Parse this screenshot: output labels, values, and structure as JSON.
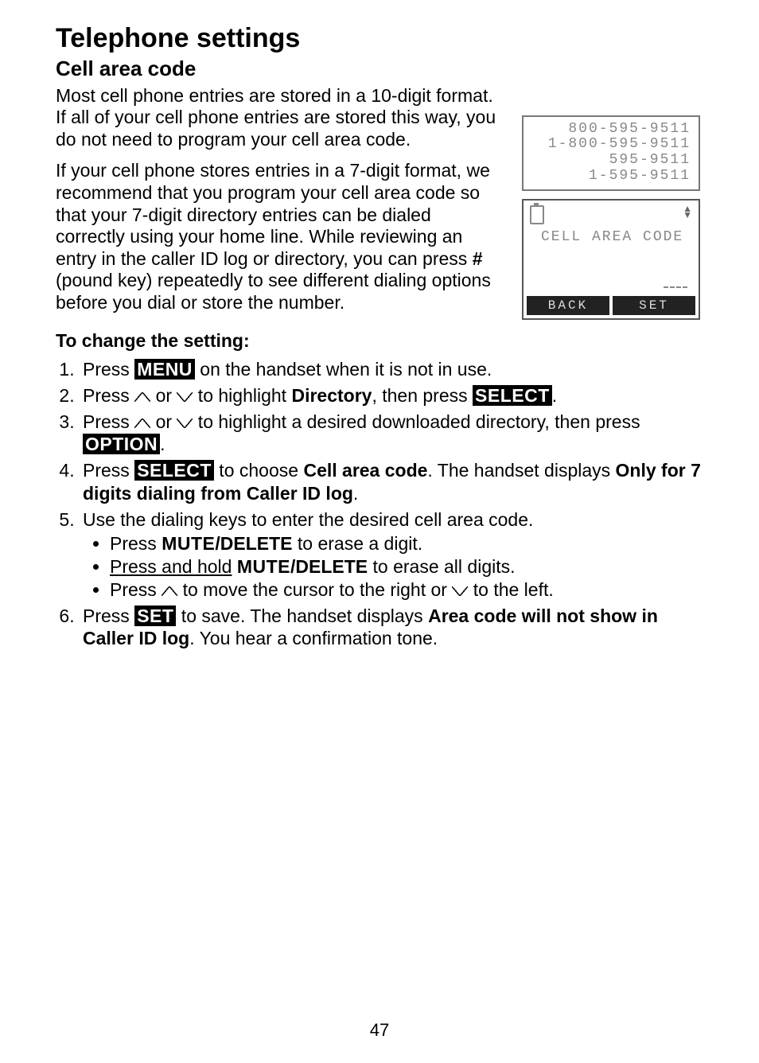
{
  "page": {
    "title": "Telephone settings",
    "subtitle": "Cell area code",
    "number": "47"
  },
  "body": {
    "p1": "Most cell phone entries are stored in a 10-digit format. If all of your cell phone entries are stored this way, you do not need to program your cell area code.",
    "p2a": "If your cell phone stores entries in a 7-digit format, we recommend that you program your cell area code so that your 7-digit directory entries can be dialed correctly using your home line. While reviewing an entry in the caller ID log or directory, you can press ",
    "pound": "#",
    "p2b": " (pound key) repeatedly to see different dialing options before you dial or store the number.",
    "instrHeading": "To change the setting:"
  },
  "keys": {
    "menu": "MENU",
    "select": "SELECT",
    "option": "OPTION",
    "set": "SET",
    "mute": "MUTE",
    "delete": "/DELETE"
  },
  "steps": {
    "s1a": "Press ",
    "s1b": " on the handset when it is not in use.",
    "s2a": "Press ",
    "s2b": " or ",
    "s2c": " to highlight ",
    "s2d": "Directory",
    "s2e": ", then press ",
    "s3a": "Press ",
    "s3b": " or ",
    "s3c": " to highlight a desired downloaded directory, then press ",
    "s4a": "Press ",
    "s4b": " to choose ",
    "s4c": "Cell area code",
    "s4d": ". The handset displays ",
    "s4e": "Only for 7 digits dialing from Caller ID log",
    "s5a": "Use the dialing keys to enter the desired cell area code.",
    "s5b1a": "Press ",
    "s5b1b": " to erase a digit.",
    "s5b2a": "Press and hold",
    "s5b2b": " to erase all digits.",
    "s5b3a": "Press ",
    "s5b3b": " to move the cursor to the right or ",
    "s5b3c": " to the left.",
    "s6a": "Press ",
    "s6b": " to save. The handset displays ",
    "s6c": "Area code will not show in Caller ID log",
    "s6d": ". You hear a confirmation tone."
  },
  "figure1": {
    "line1": "800-595-9511",
    "line2": "1-800-595-9511",
    "line3": "595-9511",
    "line4": "1-595-9511"
  },
  "figure2": {
    "label": "CELL AREA CODE",
    "softLeft": "BACK",
    "softRight": "SET"
  }
}
